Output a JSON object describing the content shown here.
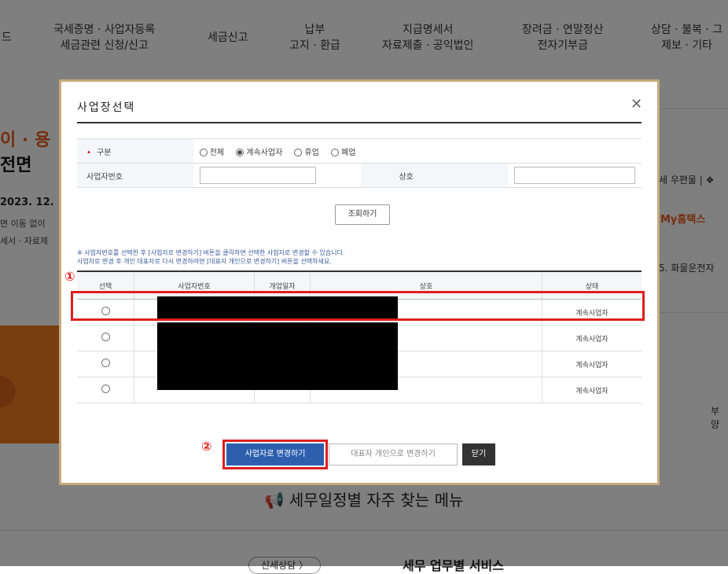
{
  "nav": {
    "item0": "드",
    "item1": "국세증명 · 사업자등록\n세금관련 신청/신고",
    "item2": "세금신고",
    "item3": "납부\n고지 · 환급",
    "item4": "지급명세서\n자료제출 · 공익법인",
    "item5": "장려금 · 연말정산\n전자기부금",
    "item6": "상담 · 불복 · 그\n제보 · 기타"
  },
  "background": {
    "hero_line1": "이 · 용",
    "hero_line2": "전면",
    "hero_date": "2023. 12.",
    "hero_small1": "면 이동 없이",
    "hero_small2": "세서 · 자료제",
    "right_text1": "세 우편물 | ❖",
    "right_myhometax": "My홈택스",
    "right_text3": "5. 화물운전자",
    "band_right": "부양",
    "section_title": "세무일정별 자주 찾는 메뉴",
    "bottom_pill": "신세상담 〉",
    "bottom_heading": "세무 업무별 서비스"
  },
  "modal": {
    "title": "사업장선택",
    "close_icon": "✕",
    "form": {
      "category_label": "구분",
      "required_mark": "•",
      "radio_options": [
        "전체",
        "계속사업자",
        "휴업",
        "폐업"
      ],
      "radio_selected": "계속사업자",
      "bizno_label": "사업자번호",
      "bizno_value": "",
      "name_label": "상호",
      "name_value": ""
    },
    "search_button": "조회하기",
    "notice": "※ 사업자번호를 선택한 후 [사업자로 변경하기] 버튼을 클릭하면 선택한 사업자로 변경할 수 있습니다.\n    사업자로 변경 후 개인 대표자로 다시 변경하려면 [대표자 개인으로 변경하기] 버튼을 선택하세요.",
    "table": {
      "headers": [
        "선택",
        "사업자번호",
        "개업일자",
        "상호",
        "상태"
      ],
      "rows": [
        {
          "status": "계속사업자"
        },
        {
          "status": "계속사업자"
        },
        {
          "status": "계속사업자"
        },
        {
          "status": "계속사업자"
        }
      ]
    },
    "buttons": {
      "change": "사업자로 변경하기",
      "rep": "대표자 개인으로 변경하기",
      "close": "닫기"
    },
    "markers": {
      "one": "①",
      "two": "②"
    }
  },
  "colors": {
    "accent_orange": "#f27c1f",
    "primary_button": "#2d5fae",
    "highlight_red": "#e01e1e"
  }
}
